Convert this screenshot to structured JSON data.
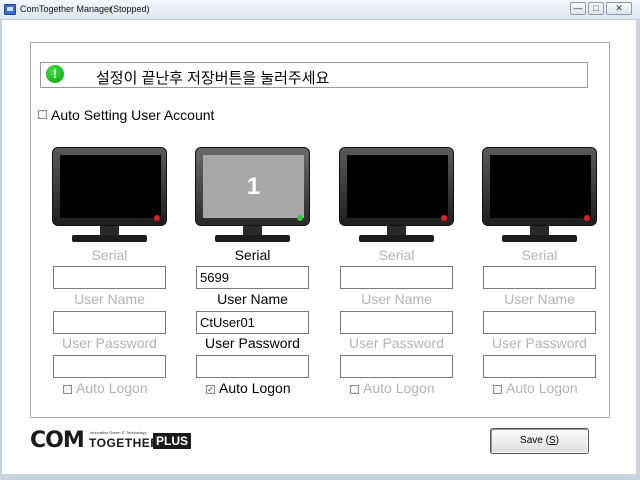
{
  "window": {
    "title": "ComTogether Manager",
    "status": "(Stopped)",
    "minimize_glyph": "—",
    "maximize_glyph": "□",
    "close_glyph": "✕"
  },
  "message": {
    "icon_glyph": "!",
    "text": "설정이 끝난후 저장버튼을 눌러주세요"
  },
  "auto_setting": {
    "label": "Auto Setting User Account",
    "checked": false
  },
  "stations": [
    {
      "number": "",
      "active": false,
      "serial_label": "Serial",
      "serial_value": "",
      "user_name_label": "User Name",
      "user_name_value": "",
      "user_password_label": "User Password",
      "user_password_value": "",
      "auto_logon_label": "Auto Logon",
      "auto_logon_checked": false
    },
    {
      "number": "1",
      "active": true,
      "serial_label": "Serial",
      "serial_value": "5699",
      "user_name_label": "User Name",
      "user_name_value": "CtUser01",
      "user_password_label": "User Password",
      "user_password_value": "",
      "auto_logon_label": "Auto Logon",
      "auto_logon_checked": true
    },
    {
      "number": "",
      "active": false,
      "serial_label": "Serial",
      "serial_value": "",
      "user_name_label": "User Name",
      "user_name_value": "",
      "user_password_label": "User Password",
      "user_password_value": "",
      "auto_logon_label": "Auto Logon",
      "auto_logon_checked": false
    },
    {
      "number": "",
      "active": false,
      "serial_label": "Serial",
      "serial_value": "",
      "user_name_label": "User Name",
      "user_name_value": "",
      "user_password_label": "User Password",
      "user_password_value": "",
      "auto_logon_label": "Auto Logon",
      "auto_logon_checked": false
    }
  ],
  "logo": {
    "com": "COM",
    "tagline": "Innovative Green IT Technology",
    "together": "TOGETHER",
    "plus": "PLUS"
  },
  "save_button": {
    "label_prefix": "Save (",
    "label_key": "S",
    "label_suffix": ")"
  },
  "colors": {
    "active_led": "#2ecc40",
    "inactive_led": "#e02020",
    "info_icon": "#11a011"
  }
}
